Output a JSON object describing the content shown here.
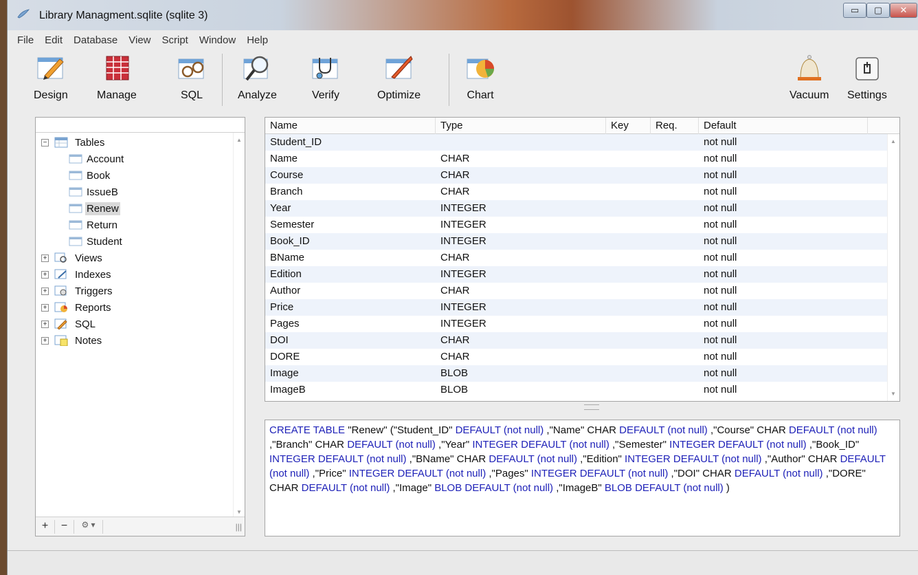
{
  "window": {
    "title": "Library Managment.sqlite (sqlite 3)",
    "controls": {
      "minimize": "▭",
      "maximize": "▢",
      "close": "✕"
    }
  },
  "menu": [
    "File",
    "Edit",
    "Database",
    "View",
    "Script",
    "Window",
    "Help"
  ],
  "toolbar": {
    "design": "Design",
    "manage": "Manage",
    "sql": "SQL",
    "analyze": "Analyze",
    "verify": "Verify",
    "optimize": "Optimize",
    "chart": "Chart",
    "vacuum": "Vacuum",
    "settings": "Settings"
  },
  "tree": {
    "tables": "Tables",
    "children": [
      "Account",
      "Book",
      "IssueB",
      "Renew",
      "Return",
      "Student"
    ],
    "views": "Views",
    "indexes": "Indexes",
    "triggers": "Triggers",
    "reports": "Reports",
    "sql": "SQL",
    "notes": "Notes",
    "footer": {
      "add": "+",
      "remove": "−",
      "gear": "⚙ ▾",
      "grip": "|||"
    }
  },
  "grid": {
    "headers": {
      "name": "Name",
      "type": "Type",
      "key": "Key",
      "req": "Req.",
      "default": "Default"
    },
    "rows": [
      {
        "name": "Student_ID",
        "type": "",
        "default": "not null"
      },
      {
        "name": "Name",
        "type": "CHAR",
        "default": "not null"
      },
      {
        "name": "Course",
        "type": "CHAR",
        "default": "not null"
      },
      {
        "name": "Branch",
        "type": "CHAR",
        "default": "not null"
      },
      {
        "name": "Year",
        "type": "INTEGER",
        "default": "not null"
      },
      {
        "name": "Semester",
        "type": "INTEGER",
        "default": "not null"
      },
      {
        "name": "Book_ID",
        "type": "INTEGER",
        "default": "not null"
      },
      {
        "name": "BName",
        "type": "CHAR",
        "default": "not null"
      },
      {
        "name": "Edition",
        "type": "INTEGER",
        "default": "not null"
      },
      {
        "name": "Author",
        "type": "CHAR",
        "default": "not null"
      },
      {
        "name": "Price",
        "type": "INTEGER",
        "default": "not null"
      },
      {
        "name": "Pages",
        "type": "INTEGER",
        "default": "not null"
      },
      {
        "name": "DOI",
        "type": "CHAR",
        "default": "not null"
      },
      {
        "name": "DORE",
        "type": "CHAR",
        "default": "not null"
      },
      {
        "name": "Image",
        "type": "BLOB",
        "default": "not null"
      },
      {
        "name": "ImageB",
        "type": "BLOB",
        "default": "not null"
      }
    ]
  },
  "sql_tokens": [
    {
      "t": "CREATE TABLE",
      "k": true
    },
    {
      "t": " \"Renew\" (\"Student_ID\"  ",
      "k": false
    },
    {
      "t": "DEFAULT",
      "k": true
    },
    {
      "t": " (not null)",
      "k": true
    },
    {
      "t": " ,\"Name\" CHAR ",
      "k": false
    },
    {
      "t": "DEFAULT (not null)",
      "k": true
    },
    {
      "t": " ,\"Course\" CHAR ",
      "k": false
    },
    {
      "t": "DEFAULT (not null)",
      "k": true
    },
    {
      "t": " ,\"Branch\" CHAR ",
      "k": false
    },
    {
      "t": "DEFAULT (not null)",
      "k": true
    },
    {
      "t": " ,\"Year\" ",
      "k": false
    },
    {
      "t": "INTEGER DEFAULT (not null)",
      "k": true
    },
    {
      "t": " ,\"Semester\" ",
      "k": false
    },
    {
      "t": "INTEGER DEFAULT (not null)",
      "k": true
    },
    {
      "t": " ,\"Book_ID\" ",
      "k": false
    },
    {
      "t": "INTEGER DEFAULT (not null)",
      "k": true
    },
    {
      "t": " ,\"BName\" CHAR ",
      "k": false
    },
    {
      "t": "DEFAULT (not null)",
      "k": true
    },
    {
      "t": " ,\"Edition\" ",
      "k": false
    },
    {
      "t": "INTEGER DEFAULT (not null)",
      "k": true
    },
    {
      "t": " ,\"Author\" CHAR ",
      "k": false
    },
    {
      "t": "DEFAULT (not null)",
      "k": true
    },
    {
      "t": " ,\"Price\" ",
      "k": false
    },
    {
      "t": "INTEGER DEFAULT (not null)",
      "k": true
    },
    {
      "t": " ,\"Pages\" ",
      "k": false
    },
    {
      "t": "INTEGER DEFAULT (not null)",
      "k": true
    },
    {
      "t": " ,\"DOI\" CHAR ",
      "k": false
    },
    {
      "t": "DEFAULT (not null)",
      "k": true
    },
    {
      "t": " ,\"DORE\" CHAR ",
      "k": false
    },
    {
      "t": "DEFAULT (not null)",
      "k": true
    },
    {
      "t": " ,\"Image\" ",
      "k": false
    },
    {
      "t": "BLOB DEFAULT (not null)",
      "k": true
    },
    {
      "t": " ,\"ImageB\" ",
      "k": false
    },
    {
      "t": "BLOB DEFAULT (not null)",
      "k": true
    },
    {
      "t": " )",
      "k": false
    }
  ]
}
